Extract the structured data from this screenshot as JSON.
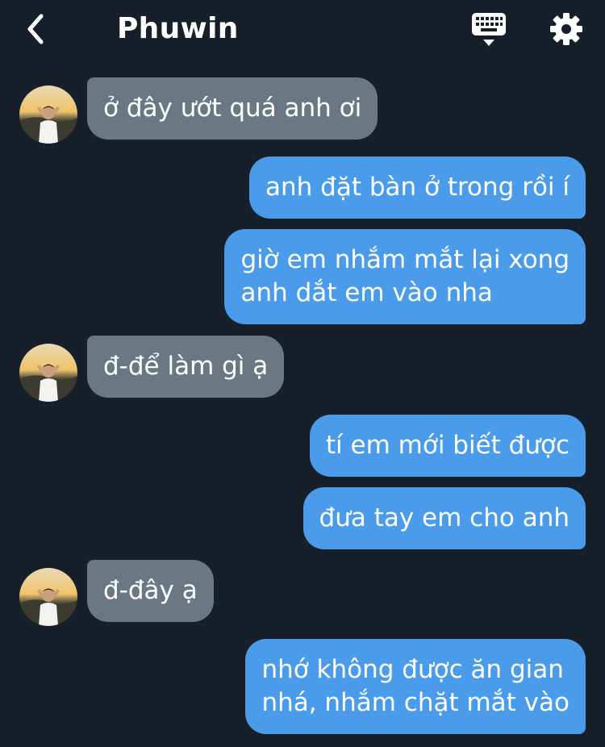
{
  "header": {
    "title": "Phuwin",
    "back_icon": "chevron-left-icon",
    "keyboard_icon": "keyboard-icon",
    "settings_icon": "gear-icon"
  },
  "colors": {
    "background": "#171f2a",
    "incoming_bubble": "#6b7884",
    "outgoing_bubble": "#4a9be9",
    "text": "#ffffff"
  },
  "messages": [
    {
      "side": "in",
      "lines": [
        "ở đây ướt quá anh ơi"
      ]
    },
    {
      "side": "out",
      "lines": [
        "anh đặt bàn ở trong rồi í"
      ]
    },
    {
      "side": "out",
      "lines": [
        "giờ em nhắm mắt lại xong",
        "anh dắt em vào nha"
      ]
    },
    {
      "side": "in",
      "lines": [
        "đ-để làm gì ạ"
      ]
    },
    {
      "side": "out",
      "lines": [
        "tí em mới biết được"
      ]
    },
    {
      "side": "out",
      "lines": [
        "đưa tay em cho anh"
      ]
    },
    {
      "side": "in",
      "lines": [
        "đ-đây ạ"
      ]
    },
    {
      "side": "out",
      "lines": [
        "nhớ không được ăn gian",
        "nhá, nhắm chặt mắt vào"
      ]
    }
  ]
}
